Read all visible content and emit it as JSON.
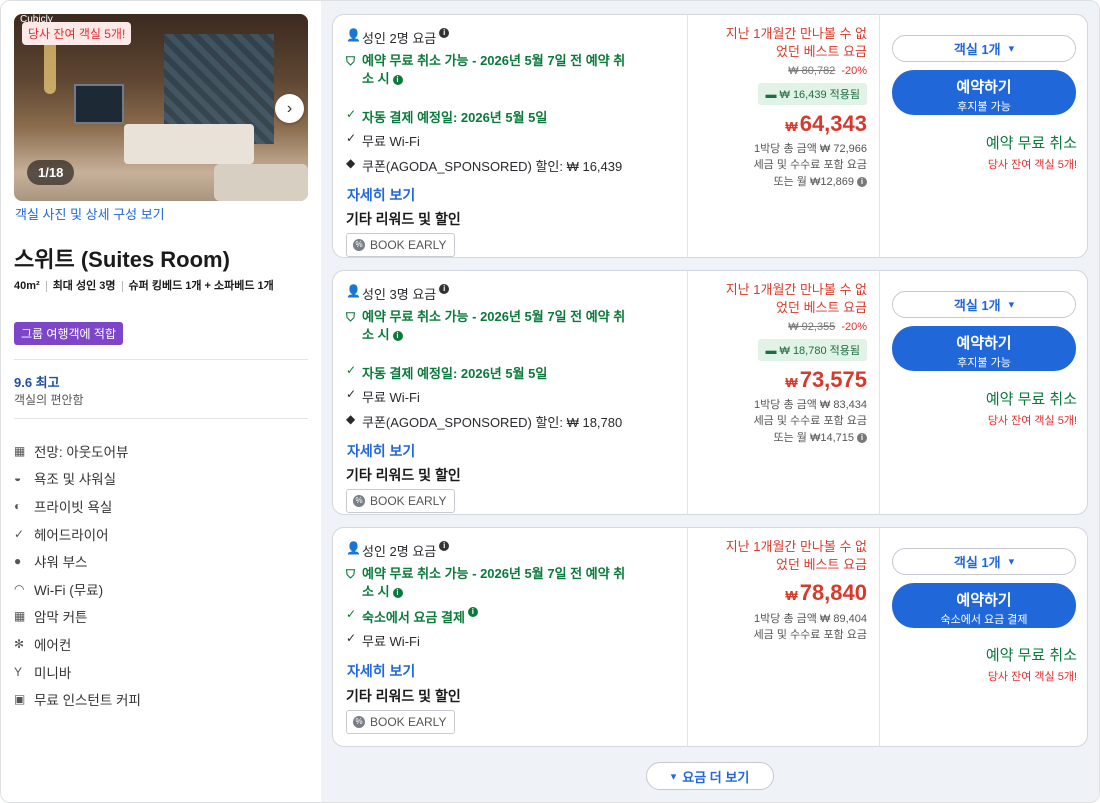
{
  "left": {
    "photo_brand": "Cubicly",
    "availability_tag": "당사 잔여 객실 5개!",
    "photo_counter": "1/18",
    "photo_link": "객실 사진 및 상세 구성 보기",
    "room_title": "스위트 (Suites Room)",
    "specs": {
      "size": "40m²",
      "max_adults": "최대 성인 3명",
      "beds": "슈퍼 킹베드 1개 + 소파베드 1개"
    },
    "group_tag": "그룹 여행객에 적합",
    "score": "9.6 최고",
    "score_sub": "객실의 편안함",
    "amenities": [
      {
        "icon": "view-icon",
        "glyph": "▦",
        "label": "전망: 아웃도어뷰"
      },
      {
        "icon": "bathtub-icon",
        "glyph": "◒",
        "label": "욕조 및 샤워실"
      },
      {
        "icon": "private-bath-icon",
        "glyph": "◐",
        "label": "프라이빗 욕실"
      },
      {
        "icon": "checkmark-icon",
        "glyph": "✓",
        "label": "헤어드라이어"
      },
      {
        "icon": "shower-icon",
        "glyph": "●",
        "label": "샤워 부스"
      },
      {
        "icon": "wifi-icon",
        "glyph": "◠",
        "label": "Wi-Fi (무료)"
      },
      {
        "icon": "curtain-icon",
        "glyph": "▦",
        "label": "암막 커튼"
      },
      {
        "icon": "aircon-icon",
        "glyph": "✻",
        "label": "에어컨"
      },
      {
        "icon": "minibar-icon",
        "glyph": "Y",
        "label": "미니바"
      },
      {
        "icon": "coffee-icon",
        "glyph": "▣",
        "label": "무료 인스턴트 커피"
      }
    ]
  },
  "offers": [
    {
      "occupancy": "성인 2명 요금",
      "cancel_line1": "예약 무료 취소 가능 - 2026년 5월 7일 전 예약 취",
      "cancel_line2": "소 시",
      "payment": "자동 결제 예정일: 2026년 5월 5일",
      "wifi": "무료 Wi-Fi",
      "coupon": "쿠폰(AGODA_SPONSORED) 할인: ₩ 16,439",
      "detail_link": "자세히 보기",
      "reward": "기타 리워드 및 할인",
      "book_early": "BOOK EARLY",
      "best_rate_1": "지난 1개월간 만나볼 수 없",
      "best_rate_2": "었던 베스트 요금",
      "original_price": "₩ 80,782",
      "discount_pct": "-20%",
      "applied": "₩ 16,439 적용됨",
      "currency": "₩",
      "price": "64,343",
      "per_night": "1박당 총 금액 ₩ 72,966",
      "tax_note": "세금 및 수수료 포함 요금",
      "monthly": "또는 월 ₩12,869",
      "qty": "객실 1개",
      "book_label": "예약하기",
      "book_sub": "후지불 가능",
      "free_cancel": "예약 무료 취소",
      "rooms_left": "당사 잔여 객실 5개!"
    },
    {
      "occupancy": "성인 3명 요금",
      "cancel_line1": "예약 무료 취소 가능 - 2026년 5월 7일 전 예약 취",
      "cancel_line2": "소 시",
      "payment": "자동 결제 예정일: 2026년 5월 5일",
      "wifi": "무료 Wi-Fi",
      "coupon": "쿠폰(AGODA_SPONSORED) 할인: ₩ 18,780",
      "detail_link": "자세히 보기",
      "reward": "기타 리워드 및 할인",
      "book_early": "BOOK EARLY",
      "best_rate_1": "지난 1개월간 만나볼 수 없",
      "best_rate_2": "었던 베스트 요금",
      "original_price": "₩ 92,355",
      "discount_pct": "-20%",
      "applied": "₩ 18,780 적용됨",
      "currency": "₩",
      "price": "73,575",
      "per_night": "1박당 총 금액 ₩ 83,434",
      "tax_note": "세금 및 수수료 포함 요금",
      "monthly": "또는 월 ₩14,715",
      "qty": "객실 1개",
      "book_label": "예약하기",
      "book_sub": "후지불 가능",
      "free_cancel": "예약 무료 취소",
      "rooms_left": "당사 잔여 객실 5개!"
    },
    {
      "occupancy": "성인 2명 요금",
      "cancel_line1": "예약 무료 취소 가능 - 2026년 5월 7일 전 예약 취",
      "cancel_line2": "소 시",
      "payment": "숙소에서 요금 결제",
      "wifi": "무료 Wi-Fi",
      "detail_link": "자세히 보기",
      "reward": "기타 리워드 및 할인",
      "book_early": "BOOK EARLY",
      "best_rate_1": "지난 1개월간 만나볼 수 없",
      "best_rate_2": "었던 베스트 요금",
      "currency": "₩",
      "price": "78,840",
      "per_night": "1박당 총 금액 ₩ 89,404",
      "tax_note": "세금 및 수수료 포함 요금",
      "qty": "객실 1개",
      "book_label": "예약하기",
      "book_sub": "숙소에서 요금 결제",
      "free_cancel": "예약 무료 취소",
      "rooms_left": "당사 잔여 객실 5개!"
    }
  ],
  "more_rates": "요금 더 보기",
  "colors": {
    "accent": "#2067da",
    "price_red": "#d7392d",
    "green": "#0a7a3b",
    "group_tag": "#7d46c9",
    "panel_bg": "#eff2f7"
  }
}
